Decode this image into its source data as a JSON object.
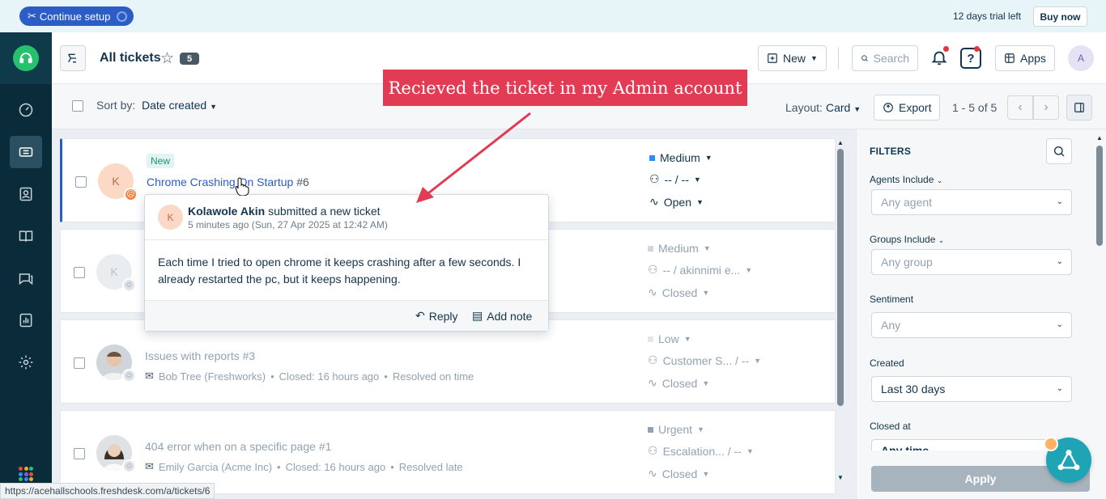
{
  "topbar": {
    "continue_setup": "Continue setup",
    "trial_text": "12 days trial left",
    "buy_now": "Buy now"
  },
  "header": {
    "title": "All tickets",
    "count": "5",
    "new_label": "New",
    "search_label": "Search",
    "apps_label": "Apps",
    "avatar_initial": "A"
  },
  "toolbar": {
    "sort_label": "Sort by:",
    "sort_value": "Date created",
    "layout_label": "Layout:",
    "layout_value": "Card",
    "export_label": "Export",
    "pagination": "1 - 5 of 5"
  },
  "tickets": [
    {
      "tag": "New",
      "subject": "Chrome Crashing On Startup",
      "number": "#6",
      "avatar": "K",
      "priority": "Medium",
      "priority_color": "#2c8ef8",
      "assignee": "-- / --",
      "status": "Open"
    },
    {
      "avatar": "K",
      "priority": "Medium",
      "priority_color": "#cfd7df",
      "assignee": "-- / akinnimi e...",
      "status": "Closed"
    },
    {
      "subject": "Issues with reports",
      "number": "#3",
      "requester": "Bob Tree (Freshworks)",
      "closed": "Closed: 16 hours ago",
      "sla": "Resolved on time",
      "priority": "Low",
      "priority_color": "#e2e7ec",
      "assignee": "Customer S... / --",
      "status": "Closed"
    },
    {
      "subject": "404 error when on a specific page",
      "number": "#1",
      "requester": "Emily Garcia (Acme Inc)",
      "closed": "Closed: 16 hours ago",
      "sla": "Resolved late",
      "priority": "Urgent",
      "priority_color": "#92a2b1",
      "assignee": "Escalation... / --",
      "status": "Closed"
    }
  ],
  "popover": {
    "avatar": "K",
    "name": "Kolawole Akin",
    "action": "submitted a new ticket",
    "time": "5 minutes ago (Sun, 27 Apr 2025 at 12:42 AM)",
    "body": "Each time I tried to open chrome it keeps crashing after a few seconds. I already restarted the pc, but it keeps happening.",
    "reply": "Reply",
    "add_note": "Add note"
  },
  "filters": {
    "title": "FILTERS",
    "agents_label": "Agents Include",
    "agents_placeholder": "Any agent",
    "groups_label": "Groups Include",
    "groups_placeholder": "Any group",
    "sentiment_label": "Sentiment",
    "sentiment_placeholder": "Any",
    "created_label": "Created",
    "created_value": "Last 30 days",
    "closed_label": "Closed at",
    "closed_placeholder": "Any time",
    "apply": "Apply"
  },
  "status_url": "https://acehallschools.freshdesk.com/a/tickets/6",
  "annotation": "Recieved the ticket in my Admin account",
  "colors": {
    "brand_blue": "#2c5cc5",
    "sidebar": "#0a2c3a",
    "annotation_red": "#e23c55",
    "logo_green": "#25c16f"
  }
}
